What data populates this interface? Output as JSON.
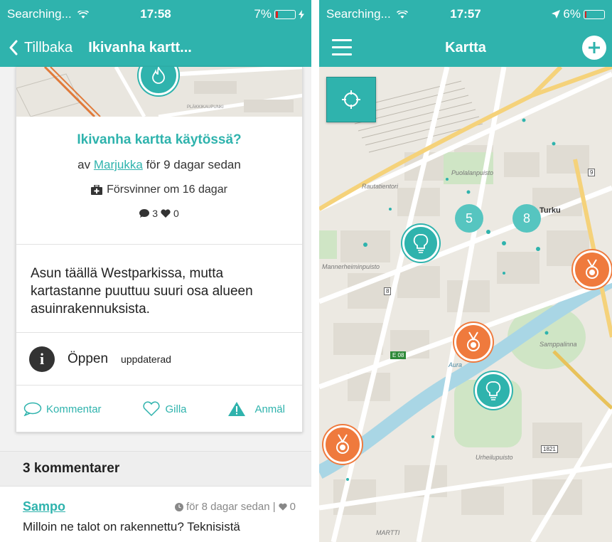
{
  "status_left": {
    "carrier": "Searching...",
    "time": "17:58",
    "battery": "7%"
  },
  "status_right": {
    "carrier": "Searching...",
    "time": "17:57",
    "battery": "6%"
  },
  "left_nav": {
    "back_label": "Tillbaka",
    "title": "Ikivanha kartt..."
  },
  "post": {
    "title": "Ikivanha kartta käytössä?",
    "byline_prefix": "av",
    "author": "Marjukka",
    "byline_suffix": "för 9 dagar sedan",
    "expires": "Försvinner om 16 dagar",
    "comment_count": "3",
    "like_count": "0",
    "body": "Asun täällä Westparkissa, mutta kartastanne puuttuu suuri osa alueen asuinrakennuksista.",
    "status": "Öppen",
    "status_tag": "uppdaterad"
  },
  "actions": {
    "comment": "Kommentar",
    "like": "Gilla",
    "report": "Anmäl"
  },
  "comments": {
    "header": "3 kommentarer",
    "items": [
      {
        "author": "Sampo",
        "time": "för 8 dagar sedan |",
        "likes": "0",
        "text": "Milloin ne talot on rakennettu? Teknisistä"
      }
    ]
  },
  "right_nav": {
    "title": "Kartta"
  },
  "map": {
    "clusters": [
      "5",
      "8"
    ],
    "labels": {
      "city": "Turku",
      "puolala": "Puolalanpuisto",
      "rautatie": "Rautatientori",
      "sampo": "Samppalinna",
      "urheilu": "Urheilupuisto",
      "manner": "Mannerheiminpuisto",
      "martti": "MARTTI",
      "plakki": "PLÄKKIKAUPUNKI",
      "aura": "Aura"
    },
    "shields": [
      "8",
      "8",
      "8",
      "9",
      "E 08",
      "1821"
    ]
  },
  "colors": {
    "brand": "#2fb3ad",
    "medal": "#ef7a3d"
  }
}
